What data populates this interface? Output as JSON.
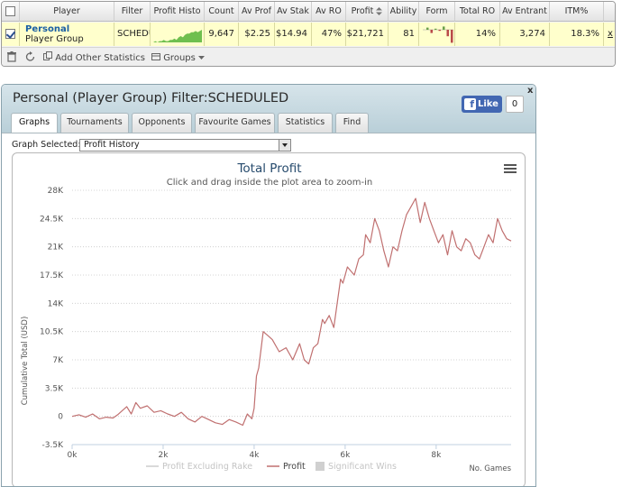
{
  "stats_table": {
    "columns": [
      "Player",
      "Filter",
      "Profit Histo",
      "Count",
      "Av Prof",
      "Av Stak",
      "Av RO",
      "Profit",
      "Ability",
      "Form",
      "Total RO",
      "Av Entrant",
      "ITM%"
    ],
    "row": {
      "checked": true,
      "player_name": "Personal",
      "player_group": "Player Group",
      "filter": "SCHEDU",
      "count": "9,647",
      "av_profit": "$2.25",
      "av_stake": "$14.94",
      "av_roi": "47%",
      "profit": "$21,721",
      "ability": "81",
      "total_roi": "14%",
      "av_entrants": "3,274",
      "itm": "18.3%",
      "remove": "x"
    },
    "sparkline_values": [
      0,
      1,
      0,
      1,
      1,
      2,
      1,
      1,
      2,
      2,
      3,
      2,
      4,
      5,
      4,
      6,
      7,
      7,
      8,
      8,
      9,
      8,
      9,
      10
    ],
    "form_values": [
      2,
      -3,
      1,
      -1,
      3,
      -6,
      -12
    ],
    "toolbar": {
      "add_stats": "Add Other Statistics",
      "groups": "Groups"
    }
  },
  "panel": {
    "title": "Personal (Player Group) Filter:SCHEDULED",
    "tabs": [
      "Graphs",
      "Tournaments",
      "Opponents",
      "Favourite Games",
      "Statistics",
      "Find"
    ],
    "active_tab": "Graphs",
    "like_label": "Like",
    "like_count": "0",
    "close": "x",
    "graph_selected_label": "Graph Selected:",
    "graph_selected_value": "Profit History"
  },
  "colors": {
    "profit_line": "#c07070",
    "sparkline": "#6fbf4f",
    "header_bg": "#c9dbe3",
    "row_highlight": "#ffffcc"
  },
  "chart_data": {
    "type": "line",
    "title": "Total Profit",
    "subtitle": "Click and drag inside the plot area to zoom-in",
    "ylabel": "Cumulative Total (USD)",
    "xlabel": "No. Games",
    "xlim": [
      0,
      9647
    ],
    "ylim": [
      -3500,
      28000
    ],
    "y_ticks": [
      -3500,
      0,
      3500,
      7000,
      10500,
      14000,
      17500,
      21000,
      24500,
      28000
    ],
    "y_tick_labels": [
      "-3.5K",
      "0",
      "3.5K",
      "7K",
      "10.5K",
      "14K",
      "17.5K",
      "21K",
      "24.5K",
      "28K"
    ],
    "x_ticks": [
      0,
      2000,
      4000,
      6000,
      8000
    ],
    "x_tick_labels": [
      "0k",
      "2k",
      "4k",
      "6k",
      "8k"
    ],
    "grid": true,
    "legend": [
      "Profit Excluding Rake",
      "Profit",
      "Significant Wins"
    ],
    "legend_position": "bottom",
    "series": [
      {
        "name": "Profit",
        "x": [
          0,
          150,
          300,
          450,
          600,
          750,
          900,
          1000,
          1100,
          1200,
          1300,
          1400,
          1500,
          1650,
          1800,
          1950,
          2100,
          2250,
          2400,
          2550,
          2700,
          2850,
          3000,
          3150,
          3300,
          3450,
          3600,
          3750,
          3850,
          3950,
          4000,
          4050,
          4100,
          4200,
          4300,
          4400,
          4550,
          4700,
          4850,
          5000,
          5100,
          5200,
          5300,
          5400,
          5500,
          5550,
          5650,
          5750,
          5800,
          5900,
          5950,
          6050,
          6200,
          6300,
          6400,
          6450,
          6550,
          6650,
          6750,
          6850,
          6950,
          7050,
          7150,
          7250,
          7350,
          7450,
          7550,
          7650,
          7750,
          7850,
          7950,
          8050,
          8150,
          8250,
          8350,
          8450,
          8550,
          8650,
          8750,
          8850,
          8950,
          9050,
          9150,
          9250,
          9350,
          9450,
          9550,
          9647
        ],
        "values": [
          0,
          200,
          -100,
          300,
          -300,
          -100,
          -200,
          200,
          700,
          1200,
          300,
          1700,
          1000,
          1300,
          500,
          700,
          300,
          0,
          500,
          -300,
          -700,
          0,
          -400,
          -800,
          -1000,
          -400,
          -700,
          -1100,
          300,
          -300,
          1000,
          5000,
          6000,
          10500,
          10000,
          9500,
          8000,
          8500,
          7000,
          9000,
          7000,
          6500,
          8500,
          9000,
          12000,
          11500,
          12500,
          11000,
          13000,
          17000,
          16500,
          18500,
          17500,
          19500,
          20000,
          22500,
          21500,
          24500,
          23000,
          20500,
          18500,
          21000,
          20500,
          23000,
          25000,
          26000,
          27000,
          24000,
          26500,
          24500,
          23000,
          21500,
          22500,
          20000,
          23000,
          21000,
          20500,
          22000,
          21500,
          20000,
          19500,
          21000,
          22500,
          21500,
          24500,
          23000,
          22000,
          21721
        ]
      }
    ]
  }
}
